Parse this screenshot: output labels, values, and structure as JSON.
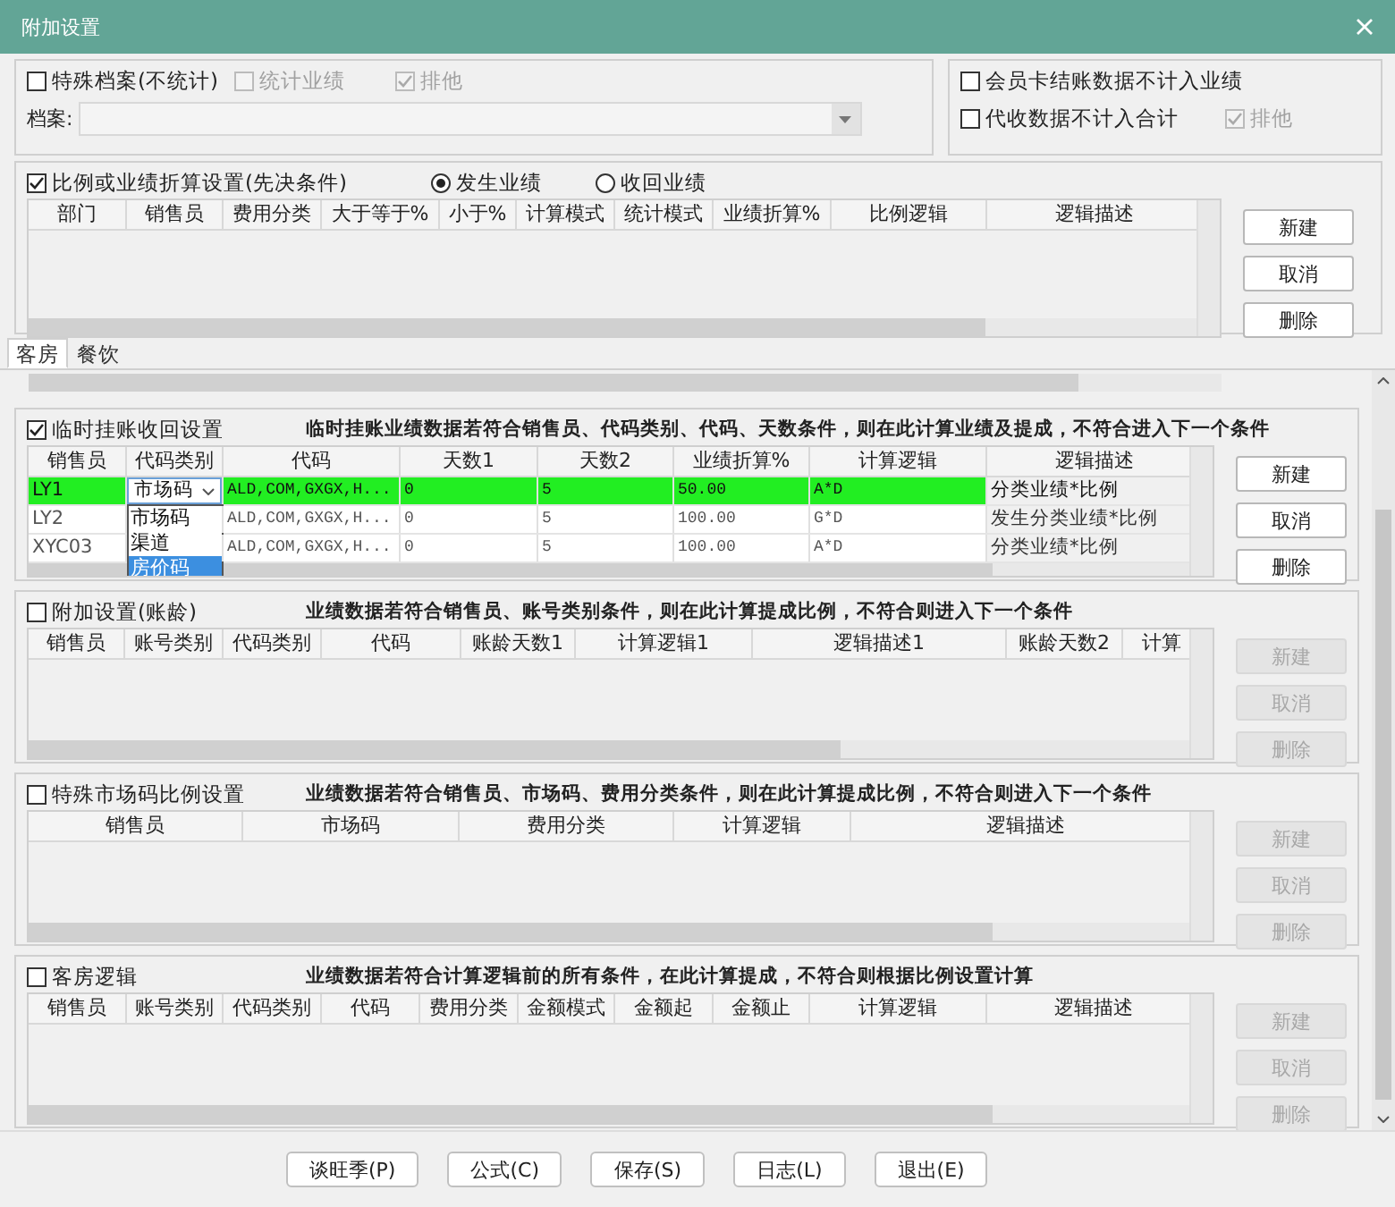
{
  "window": {
    "title": "附加设置"
  },
  "top_left": {
    "checks": [
      {
        "label": "特殊档案(不统计)",
        "checked": false,
        "disabled": false
      },
      {
        "label": "统计业绩",
        "checked": false,
        "disabled": true
      },
      {
        "label": "排他",
        "checked": true,
        "disabled": true
      }
    ],
    "archive_label": "档案:"
  },
  "top_right": {
    "checks": [
      {
        "label": "会员卡结账数据不计入业绩",
        "checked": false,
        "disabled": false
      },
      {
        "label": "代收数据不计入合计",
        "checked": false,
        "disabled": false
      },
      {
        "label": "排他",
        "checked": true,
        "disabled": true
      }
    ]
  },
  "ratio_section": {
    "label": "比例或业绩折算设置(先决条件)",
    "checked": true,
    "radios": [
      {
        "label": "发生业绩",
        "selected": true
      },
      {
        "label": "收回业绩",
        "selected": false
      }
    ],
    "columns": [
      "部门",
      "销售员",
      "费用分类",
      "大于等于%",
      "小于%",
      "计算模式",
      "统计模式",
      "业绩折算%",
      "比例逻辑",
      "逻辑描述"
    ],
    "buttons": [
      {
        "label": "新建",
        "disabled": false
      },
      {
        "label": "取消",
        "disabled": false
      },
      {
        "label": "删除",
        "disabled": false
      }
    ]
  },
  "tabs": [
    {
      "label": "客房",
      "selected": true
    },
    {
      "label": "餐饮",
      "selected": false
    }
  ],
  "sections": [
    {
      "label": "临时挂账收回设置",
      "checked": true,
      "description": "临时挂账业绩数据若符合销售员、代码类别、代码、天数条件，则在此计算业绩及提成，不符合进入下一个条件",
      "columns": [
        "销售员",
        "代码类别",
        "代码",
        "天数1",
        "天数2",
        "业绩折算%",
        "计算逻辑",
        "逻辑描述"
      ],
      "rows": [
        {
          "selected": true,
          "cells": [
            "LY1",
            "市场码",
            "ALD,COM,GXGX,H...",
            "0",
            "5",
            "50.00",
            "A*D",
            "分类业绩*比例"
          ],
          "dropdown": {
            "options": [
              {
                "label": "市场码",
                "selected": false
              },
              {
                "label": "渠道",
                "selected": false
              },
              {
                "label": "房价码",
                "selected": true
              }
            ]
          }
        },
        {
          "selected": false,
          "cells": [
            "LY2",
            "",
            "ALD,COM,GXGX,H...",
            "0",
            "5",
            "100.00",
            "G*D",
            "发生分类业绩*比例"
          ]
        },
        {
          "selected": false,
          "cells": [
            "XYC03",
            "",
            "ALD,COM,GXGX,H...",
            "0",
            "5",
            "100.00",
            "A*D",
            "分类业绩*比例"
          ]
        }
      ],
      "buttons": [
        {
          "label": "新建",
          "disabled": false
        },
        {
          "label": "取消",
          "disabled": false
        },
        {
          "label": "删除",
          "disabled": false
        }
      ]
    },
    {
      "label": "附加设置(账龄)",
      "checked": false,
      "description": "业绩数据若符合销售员、账号类别条件，则在此计算提成比例，不符合则进入下一个条件",
      "columns": [
        "销售员",
        "账号类别",
        "代码类别",
        "代码",
        "账龄天数1",
        "计算逻辑1",
        "逻辑描述1",
        "账龄天数2",
        "计算"
      ],
      "buttons": [
        {
          "label": "新建",
          "disabled": true
        },
        {
          "label": "取消",
          "disabled": true
        },
        {
          "label": "删除",
          "disabled": true
        }
      ]
    },
    {
      "label": "特殊市场码比例设置",
      "checked": false,
      "description": "业绩数据若符合销售员、市场码、费用分类条件，则在此计算提成比例，不符合则进入下一个条件",
      "columns": [
        "销售员",
        "市场码",
        "费用分类",
        "计算逻辑",
        "逻辑描述"
      ],
      "buttons": [
        {
          "label": "新建",
          "disabled": true
        },
        {
          "label": "取消",
          "disabled": true
        },
        {
          "label": "删除",
          "disabled": true
        }
      ]
    },
    {
      "label": "客房逻辑",
      "checked": false,
      "description": "业绩数据若符合计算逻辑前的所有条件，在此计算提成，不符合则根据比例设置计算",
      "columns": [
        "销售员",
        "账号类别",
        "代码类别",
        "代码",
        "费用分类",
        "金额模式",
        "金额起",
        "金额止",
        "计算逻辑",
        "逻辑描述"
      ],
      "buttons": [
        {
          "label": "新建",
          "disabled": true
        },
        {
          "label": "取消",
          "disabled": true
        },
        {
          "label": "删除",
          "disabled": true
        }
      ]
    }
  ],
  "footer": {
    "buttons": [
      "谈旺季(P)",
      "公式(C)",
      "保存(S)",
      "日志(L)",
      "退出(E)"
    ]
  }
}
